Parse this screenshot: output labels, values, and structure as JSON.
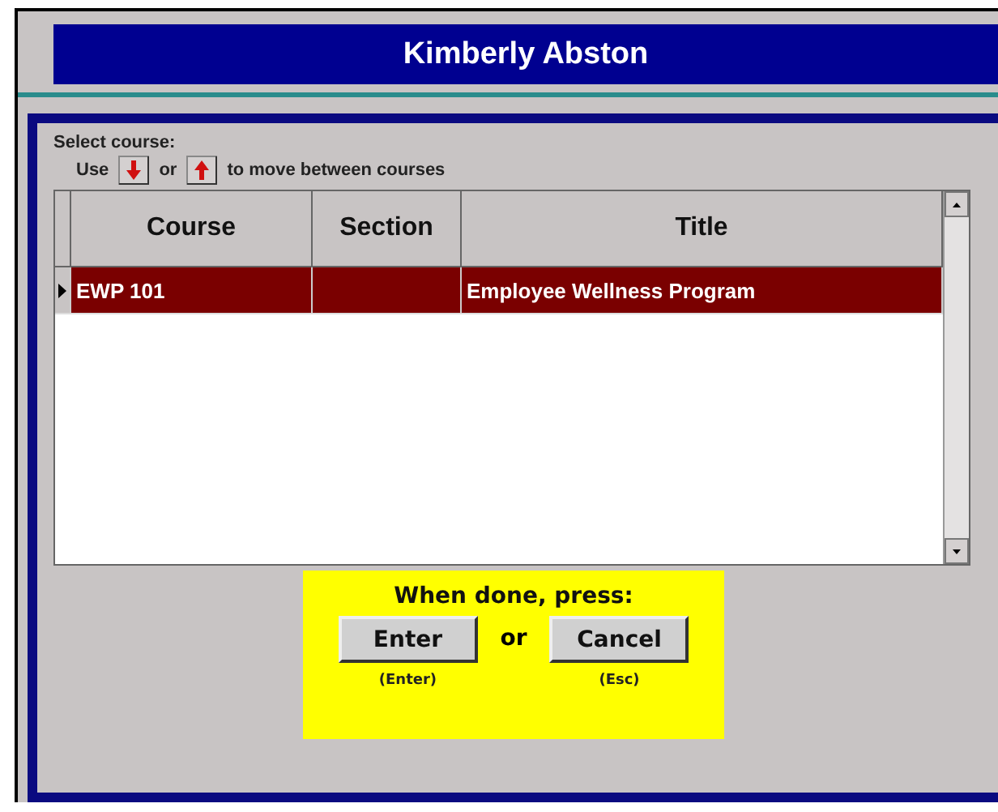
{
  "window": {
    "title": "Kimberly Abston"
  },
  "prompt": {
    "label": "Select course:",
    "hint_start": "Use",
    "hint_middle": "or",
    "hint_end": "to move between courses"
  },
  "table": {
    "columns": [
      "Course",
      "Section",
      "Title"
    ],
    "rows": [
      {
        "cells": [
          "EWP 101",
          "",
          "Employee Wellness Program"
        ],
        "selected": true
      }
    ]
  },
  "done_box": {
    "message": "When done, press:",
    "separator": "or",
    "buttons": [
      {
        "label": "Enter",
        "shortcut": "(Enter)"
      },
      {
        "label": "Cancel",
        "shortcut": "(Esc)"
      }
    ]
  }
}
